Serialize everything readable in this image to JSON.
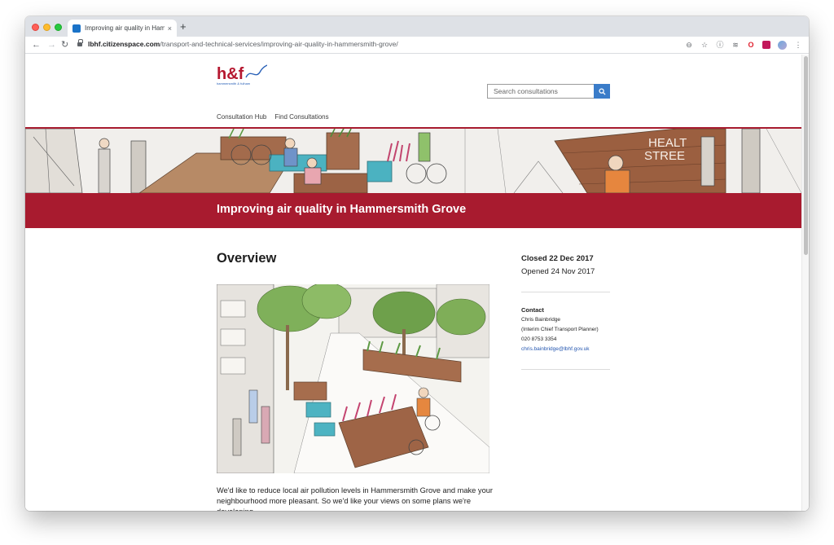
{
  "browser": {
    "tab_title": "Improving air quality in Hamme",
    "tab_close": "×",
    "new_tab": "+",
    "url_host": "lbhf.citizenspace.com",
    "url_path": "/transport-and-technical-services/improving-air-quality-in-hammersmith-grove/"
  },
  "site": {
    "logo_text": "h&f",
    "logo_subtext": "hammersmith & fulham",
    "search_placeholder": "Search consultations",
    "nav": [
      "Consultation Hub",
      "Find Consultations"
    ]
  },
  "hero": {
    "sign_text": [
      "HEALT",
      "STREE"
    ]
  },
  "page": {
    "title": "Improving air quality in Hammersmith Grove",
    "overview_heading": "Overview",
    "intro": "We'd like to reduce local air pollution levels in Hammersmith Grove and make your neighbourhood more pleasant. So we'd like your views on some plans we're developing."
  },
  "sidebar": {
    "closed": "Closed 22 Dec 2017",
    "opened": "Opened 24 Nov 2017",
    "contact_heading": "Contact",
    "contact_name": "Chris Bainbridge",
    "contact_role": "(Interim Chief Transport Planner)",
    "contact_phone": "020 8753 3354",
    "contact_email": "chris.bainbridge@lbhf.gov.uk"
  },
  "colors": {
    "brand_red": "#a81b2f",
    "search_blue": "#3a7cc9",
    "link_blue": "#2557b0"
  }
}
